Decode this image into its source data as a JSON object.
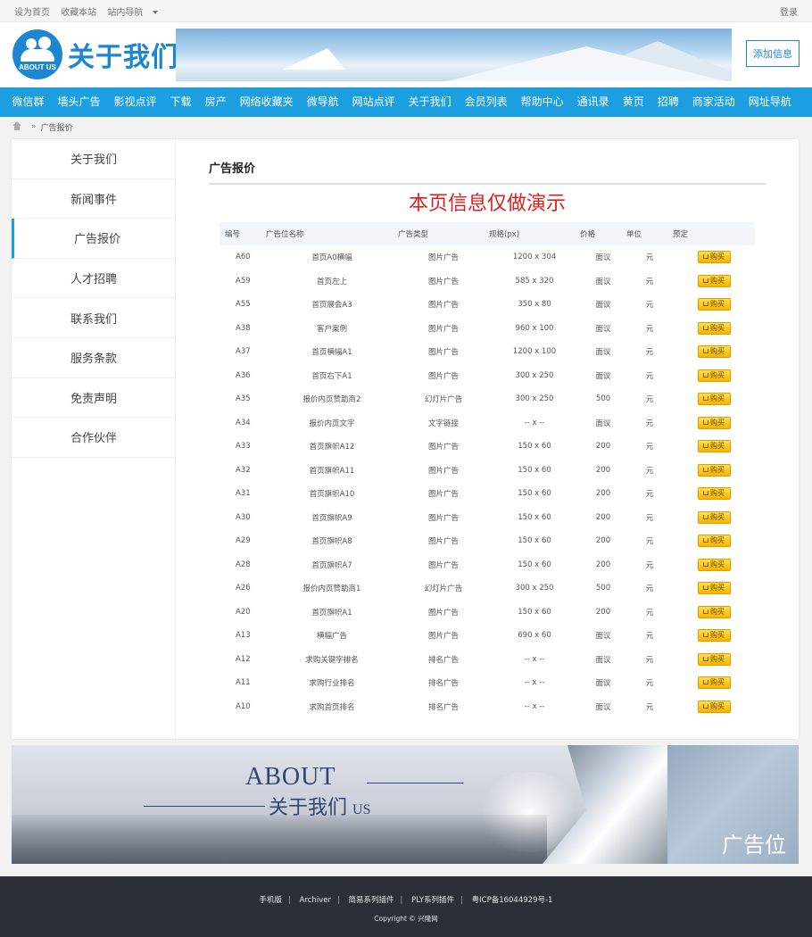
{
  "topbar": {
    "links": [
      "设为首页",
      "收藏本站",
      "站内导航"
    ],
    "login": "登录"
  },
  "header": {
    "logo_badge": "ABOUT US",
    "logo_title": "关于我们",
    "add_button": "添加信息"
  },
  "nav": [
    "微信群",
    "墙头广告",
    "影视点评",
    "下载",
    "房产",
    "网络收藏夹",
    "微导航",
    "网站点评",
    "关于我们",
    "会员列表",
    "帮助中心",
    "通讯录",
    "黄页",
    "招聘",
    "商家活动",
    "网址导航"
  ],
  "breadcrumb": {
    "separator": "»",
    "current": "广告报价"
  },
  "sidebar": [
    "关于我们",
    "新闻事件",
    "广告报价",
    "人才招聘",
    "联系我们",
    "服务条款",
    "免责声明",
    "合作伙伴"
  ],
  "content": {
    "title": "广告报价",
    "demo_notice": "本页信息仅做演示",
    "columns": [
      "编号",
      "广告位名称",
      "广告类型",
      "规格(px)",
      "价格",
      "单位",
      "预定"
    ],
    "buy_label": "购买",
    "rows": [
      [
        "A60",
        "首页A0横幅",
        "图片广告",
        "1200 x 304",
        "面议",
        "元"
      ],
      [
        "A59",
        "首页左上",
        "图片广告",
        "585 x 320",
        "面议",
        "元"
      ],
      [
        "A55",
        "首页展会A3",
        "图片广告",
        "350 x 80",
        "面议",
        "元"
      ],
      [
        "A38",
        "客户案例",
        "图片广告",
        "960 x 100",
        "面议",
        "元"
      ],
      [
        "A37",
        "首页横幅A1",
        "图片广告",
        "1200 x 100",
        "面议",
        "元"
      ],
      [
        "A36",
        "首页右下A1",
        "图片广告",
        "300 x 250",
        "面议",
        "元"
      ],
      [
        "A35",
        "报价内页赞助商2",
        "幻灯片广告",
        "300 x 250",
        "500",
        "元"
      ],
      [
        "A34",
        "报价内页文字",
        "文字链接",
        "-- x --",
        "面议",
        "元"
      ],
      [
        "A33",
        "首页旗帜A12",
        "图片广告",
        "150 x 60",
        "200",
        "元"
      ],
      [
        "A32",
        "首页旗帜A11",
        "图片广告",
        "150 x 60",
        "200",
        "元"
      ],
      [
        "A31",
        "首页旗帜A10",
        "图片广告",
        "150 x 60",
        "200",
        "元"
      ],
      [
        "A30",
        "首页旗帜A9",
        "图片广告",
        "150 x 60",
        "200",
        "元"
      ],
      [
        "A29",
        "首页旗帜A8",
        "图片广告",
        "150 x 60",
        "200",
        "元"
      ],
      [
        "A28",
        "首页旗帜A7",
        "图片广告",
        "150 x 60",
        "200",
        "元"
      ],
      [
        "A26",
        "报价内页赞助商1",
        "幻灯片广告",
        "300 x 250",
        "500",
        "元"
      ],
      [
        "A20",
        "首页旗帜A1",
        "图片广告",
        "150 x 60",
        "200",
        "元"
      ],
      [
        "A13",
        "横幅广告",
        "图片广告",
        "690 x 60",
        "面议",
        "元"
      ],
      [
        "A12",
        "求购关键字排名",
        "排名广告",
        "-- x --",
        "面议",
        "元"
      ],
      [
        "A11",
        "求购行业排名",
        "排名广告",
        "-- x --",
        "面议",
        "元"
      ],
      [
        "A10",
        "求购首页排名",
        "排名广告",
        "-- x --",
        "面议",
        "元"
      ]
    ]
  },
  "banner": {
    "about": "ABOUT",
    "subtitle": "关于我们",
    "subtitle_en": "US",
    "ad_label": "广告位"
  },
  "footer": {
    "links": [
      "手机版",
      "Archiver",
      "简易系列插件",
      "PLY系列插件",
      "粤ICP备16044929号-1"
    ],
    "copyright": "Copyright © 兴隆网"
  },
  "colors": {
    "nav": "#1c9fe0",
    "brand": "#1c87d0",
    "notice": "#e01e1e",
    "footer": "#2a2f38"
  }
}
